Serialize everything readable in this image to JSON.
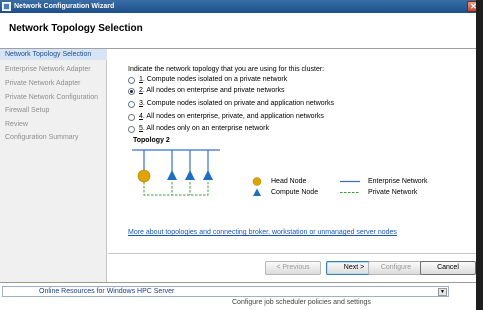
{
  "window": {
    "title": "Network Configuration Wizard",
    "close_glyph": "✕"
  },
  "header": {
    "title": "Network Topology Selection"
  },
  "sidebar": {
    "items": [
      {
        "label": "Network Topology Selection",
        "active": true
      },
      {
        "label": "Enterprise Network Adapter",
        "active": false
      },
      {
        "label": "Private Network Adapter",
        "active": false
      },
      {
        "label": "Private Network Configuration",
        "active": false
      },
      {
        "label": "Firewall Setup",
        "active": false
      },
      {
        "label": "Review",
        "active": false
      },
      {
        "label": "Configuration Summary",
        "active": false
      }
    ]
  },
  "main": {
    "intro": "Indicate the network topology that you are using for this cluster:",
    "options": [
      {
        "num": "1",
        "text": ". Compute nodes isolated on a private network",
        "checked": false
      },
      {
        "num": "2",
        "text": ". All nodes on enterprise and private networks",
        "checked": true
      },
      {
        "num": "3",
        "text": ". Compute nodes isolated on private and application networks",
        "checked": false
      },
      {
        "num": "4",
        "text": ". All nodes on enterprise, private, and application networks",
        "checked": false
      },
      {
        "num": "5",
        "text": ". All nodes only on an enterprise network",
        "checked": false
      }
    ],
    "topology_title": "Topology 2",
    "legend": {
      "head_node": "Head Node",
      "compute_node": "Compute Node",
      "enterprise_network": "Enterprise Network",
      "private_network": "Private Network"
    },
    "more_link": "More about topologies and connecting broker, workstation or unmanaged server nodes"
  },
  "footer": {
    "previous": "< Previous",
    "next": "Next >",
    "configure": "Configure",
    "cancel": "Cancel"
  },
  "background": {
    "resources_label": "Online Resources for Windows HPC Server",
    "dropdown_glyph": "▼",
    "partial_text": "Configure job scheduler policies and settings"
  },
  "colors": {
    "head_node": "#e0a400",
    "compute_node": "#1f6fc0",
    "enterprise_line": "#3a6fc4",
    "private_line": "#30a030",
    "link": "#1a55b5"
  }
}
